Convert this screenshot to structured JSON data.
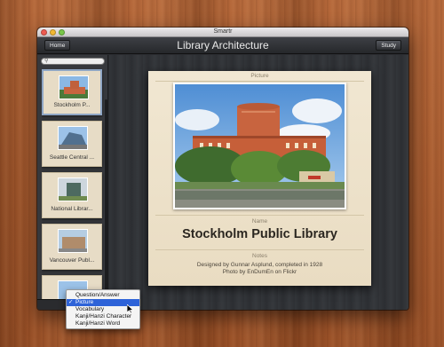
{
  "window": {
    "title": "Smartr"
  },
  "toolbar": {
    "home_label": "Home",
    "study_label": "Study",
    "title": "Library Architecture"
  },
  "sidebar": {
    "items": [
      {
        "label": "Stockholm P...",
        "selected": true
      },
      {
        "label": "Seattle Central ..."
      },
      {
        "label": "National Librar..."
      },
      {
        "label": "Vancouver Publ..."
      },
      {
        "label": ""
      }
    ]
  },
  "card": {
    "picture_label": "Picture",
    "name_label": "Name",
    "name_value": "Stockholm Public Library",
    "notes_label": "Notes",
    "notes_line1": "Designed by Gunnar Asplund, completed in 1928",
    "notes_line2": "Photo by EnDumEn on Flickr"
  },
  "menu": {
    "options": [
      {
        "label": "Question/Answer"
      },
      {
        "label": "Picture",
        "checked": true
      },
      {
        "label": "Vocabulary"
      },
      {
        "label": "Kanji/Hanzi Character"
      },
      {
        "label": "Kanji/Hanzi Word"
      }
    ]
  },
  "colors": {
    "accent": "#2e63d8",
    "card_bg": "#f1e7d2",
    "building": "#c8643f",
    "sky": "#6da6de"
  }
}
